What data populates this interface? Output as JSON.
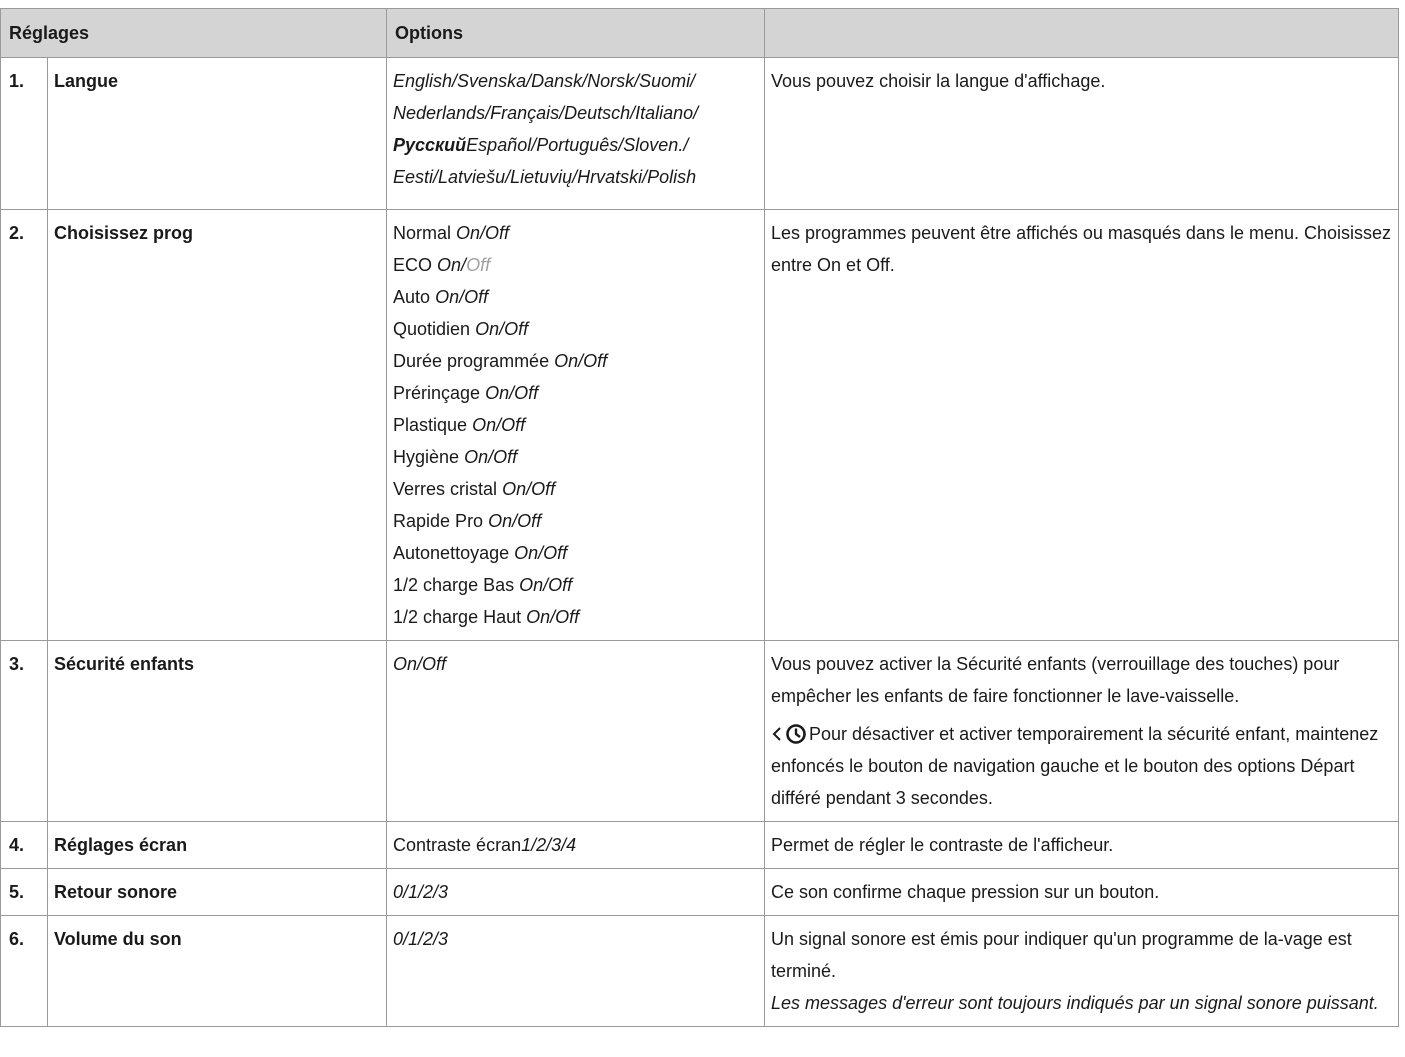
{
  "header": {
    "col_settings": "Réglages",
    "col_options": "Options",
    "col_description": ""
  },
  "rows": [
    {
      "number": "1.",
      "name": "Langue",
      "language_lines": [
        "English/Svenska/Dansk/Norsk/Suomi/",
        "Nederlands/Français/Deutsch/Italiano/",
        "Español/Português/Sloven./",
        "Eesti/Latviešu/Lietuvių/Hrvatski/Polish"
      ],
      "language_russian": "Русский",
      "description": "Vous pouvez choisir la langue d'affichage."
    },
    {
      "number": "2.",
      "name": "Choisissez prog",
      "programs": [
        {
          "label": "Normal",
          "toggle": "On/Off"
        },
        {
          "label": "ECO",
          "toggle_on": "On/",
          "toggle_off": "Off"
        },
        {
          "label": "Auto",
          "toggle": "On/Off"
        },
        {
          "label": "Quotidien",
          "toggle": "On/Off"
        },
        {
          "label": "Durée programmée",
          "toggle": "On/Off"
        },
        {
          "label": "Prérinçage",
          "toggle": "On/Off"
        },
        {
          "label": "Plastique",
          "toggle": "On/Off"
        },
        {
          "label": "Hygiène",
          "toggle": "On/Off"
        },
        {
          "label": "Verres cristal",
          "toggle": "On/Off"
        },
        {
          "label": "Rapide Pro",
          "toggle": "On/Off"
        },
        {
          "label": "Autonettoyage",
          "toggle": "On/Off"
        },
        {
          "label": "1/2 charge Bas",
          "toggle": "On/Off"
        },
        {
          "label": "1/2 charge Haut",
          "toggle": "On/Off"
        }
      ],
      "description": "Les programmes peuvent être affichés ou masqués dans le menu. Choisissez entre On et Off."
    },
    {
      "number": "3.",
      "name": "Sécurité enfants",
      "options": "On/Off",
      "description": "Vous pouvez activer la Sécurité enfants (verrouillage des touches) pour empêcher les enfants de faire fonctionner le lave-vaisselle.",
      "note_icons": [
        "chevron-left-icon",
        "clock-icon"
      ],
      "note": "Pour désactiver et activer temporairement la sécurité enfant, maintenez enfoncés le bouton de navigation gauche et le bouton des options Départ différé pendant 3 secondes."
    },
    {
      "number": "4.",
      "name": "Réglages écran",
      "options_label": "Contraste écran",
      "options_values": "1/2/3/4",
      "description": "Permet de régler le contraste de l'afficheur."
    },
    {
      "number": "5.",
      "name": "Retour sonore",
      "options": "0/1/2/3",
      "description": "Ce son confirme chaque pression sur un bouton."
    },
    {
      "number": "6.",
      "name": "Volume du son",
      "options": "0/1/2/3",
      "description": "Un signal sonore est émis pour indiquer qu'un programme de la-vage est terminé.",
      "note": "Les messages d'erreur sont toujours indiqués par un signal sonore puissant."
    }
  ]
}
